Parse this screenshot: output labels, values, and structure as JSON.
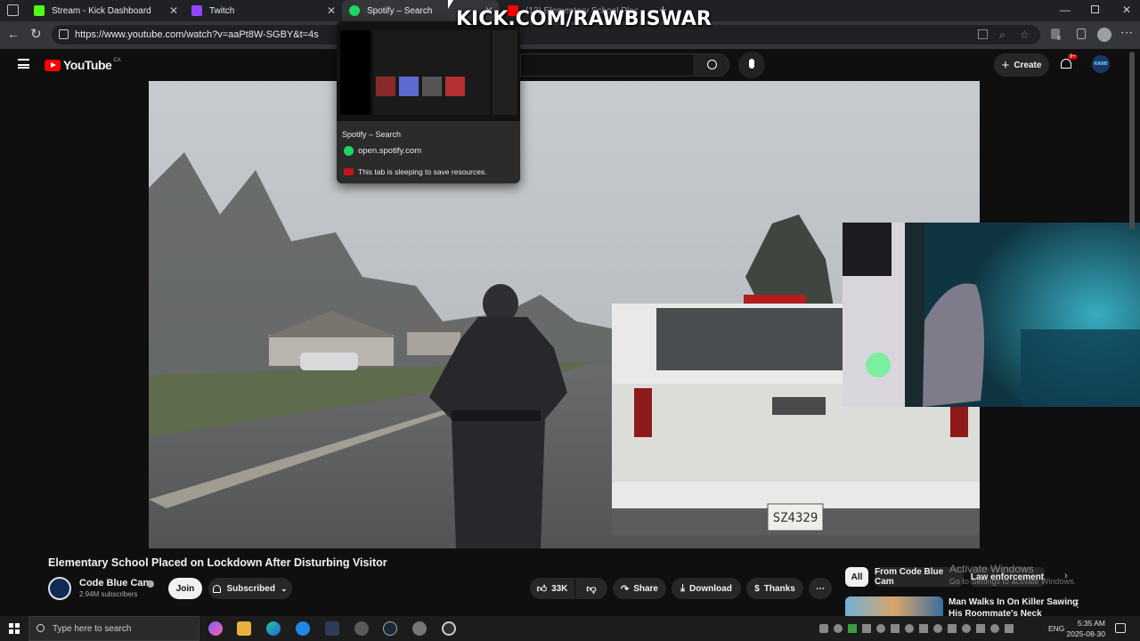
{
  "overlay_text": "KICK.COM/RAWBISWAR",
  "tabs": [
    {
      "label": "Stream - Kick Dashboard",
      "color": "#53fc18"
    },
    {
      "label": "Twitch",
      "color": "#9146ff"
    },
    {
      "label": "Spotify – Search",
      "color": "#1ed760"
    },
    {
      "label": "(13) Elementary School Plac",
      "color": "#ff0000"
    }
  ],
  "address": {
    "url": "https://www.youtube.com/watch?v=aaPt8W-SGBY&t=4s"
  },
  "tab_preview": {
    "title": "Spotify – Search",
    "domain": "open.spotify.com",
    "sleep_note": "This tab is sleeping to save resources."
  },
  "youtube": {
    "logo_text": "YouTube",
    "region": "CA",
    "create_label": "Create",
    "notif_count": "9+",
    "avatar_text": "RAWB"
  },
  "video": {
    "title": "Elementary School Placed on Lockdown After Disturbing Visitor",
    "plate": "SZ4329"
  },
  "channel": {
    "name": "Code Blue Cam",
    "subscribers": "2.94M subscribers",
    "join_label": "Join",
    "subscribed_label": "Subscribed"
  },
  "actions": {
    "likes": "33K",
    "share_label": "Share",
    "download_label": "Download",
    "thanks_label": "Thanks"
  },
  "chips": [
    "All",
    "From Code Blue Cam",
    "Law enforcement"
  ],
  "recommended": {
    "title_line1": "Man Walks In On Killer Sawing",
    "title_line2": "His Roommate's Neck"
  },
  "watermark": {
    "line1": "Activate Windows",
    "line2": "Go to Settings to activate Windows."
  },
  "taskbar": {
    "search_placeholder": "Type here to search",
    "lang": "ENG",
    "time": "5:35 AM",
    "date": "2025-08-30"
  }
}
